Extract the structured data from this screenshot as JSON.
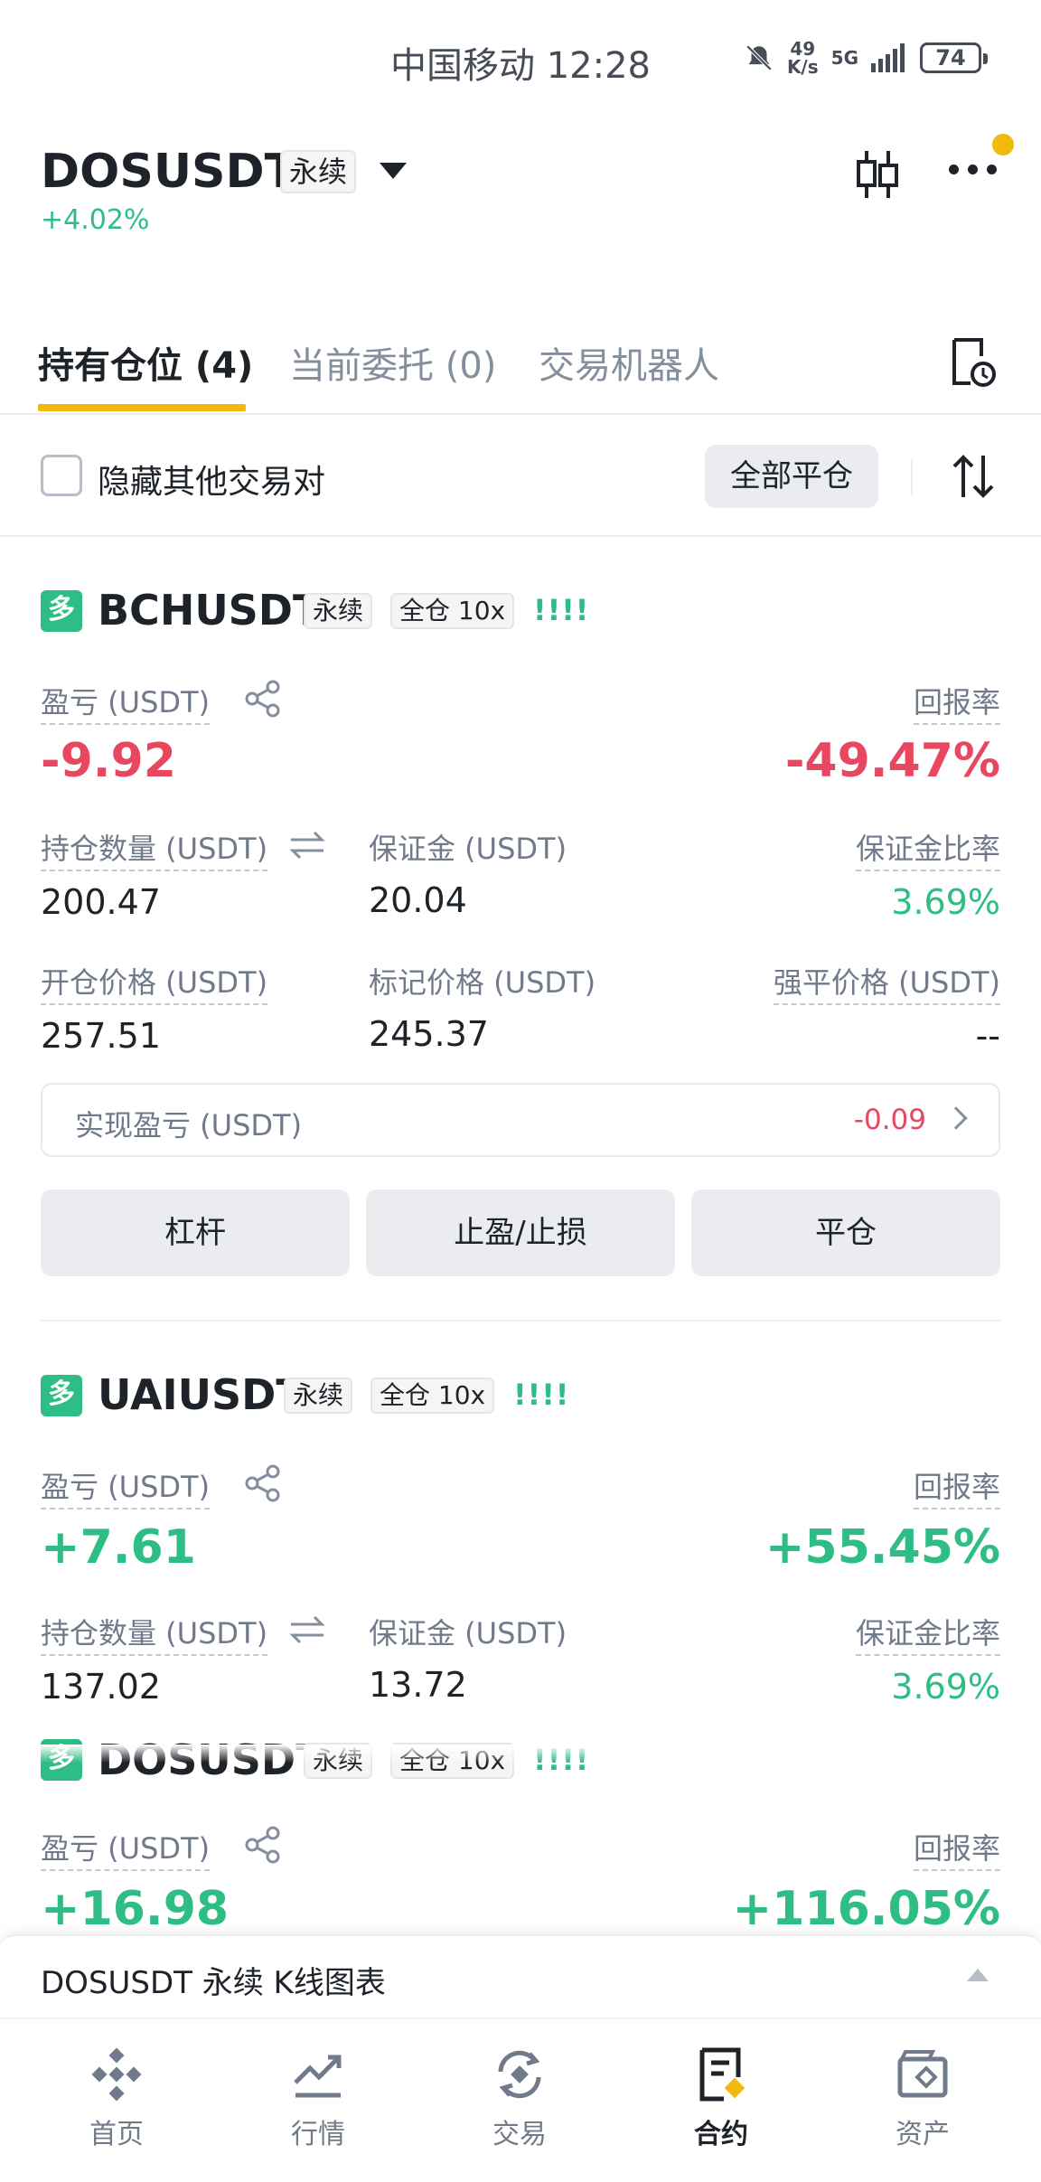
{
  "status_bar": {
    "carrier_time": "中国移动 12:28",
    "speed_value": "49",
    "speed_unit": "K/s",
    "network": "5G",
    "battery": "74"
  },
  "header": {
    "symbol": "DOSUSDT",
    "type_tag": "永续",
    "change": "+4.02%"
  },
  "tabs": [
    {
      "label": "持有仓位 (4)",
      "active": true
    },
    {
      "label": "当前委托 (0)",
      "active": false
    },
    {
      "label": "交易机器人",
      "active": false
    }
  ],
  "filter": {
    "hide_label": "隐藏其他交易对",
    "close_all": "全部平仓"
  },
  "positions": [
    {
      "side": "多",
      "symbol": "BCHUSDT",
      "type_tag": "永续",
      "margin_tag": "全仓 10x",
      "bars": "!!!!",
      "pnl_label": "盈亏 (USDT)",
      "pnl": "-9.92",
      "roe_label": "回报率",
      "roe": "-49.47%",
      "size_label": "持仓数量 (USDT)",
      "size": "200.47",
      "margin_label": "保证金 (USDT)",
      "margin": "20.04",
      "margin_ratio_label": "保证金比率",
      "margin_ratio": "3.69%",
      "entry_label": "开仓价格 (USDT)",
      "entry": "257.51",
      "mark_label": "标记价格 (USDT)",
      "mark": "245.37",
      "liq_label": "强平价格 (USDT)",
      "liq": "--",
      "realized_label": "实现盈亏 (USDT)",
      "realized": "-0.09",
      "btn_leverage": "杠杆",
      "btn_tpsl": "止盈/止损",
      "btn_close": "平仓"
    },
    {
      "side": "多",
      "symbol": "UAIUSDT",
      "type_tag": "永续",
      "margin_tag": "全仓 10x",
      "bars": "!!!!",
      "pnl_label": "盈亏 (USDT)",
      "pnl": "+7.61",
      "roe_label": "回报率",
      "roe": "+55.45%",
      "size_label": "持仓数量 (USDT)",
      "size": "137.02",
      "margin_label": "保证金 (USDT)",
      "margin": "13.72",
      "margin_ratio_label": "保证金比率",
      "margin_ratio": "3.69%"
    },
    {
      "side": "多",
      "symbol": "DOSUSDT",
      "type_tag": "永续",
      "margin_tag": "全仓 10x",
      "bars": "!!!!",
      "pnl_label": "盈亏 (USDT)",
      "pnl": "+16.98",
      "roe_label": "回报率",
      "roe": "+116.05%"
    }
  ],
  "chart_bar": {
    "label": "DOSUSDT 永续 K线图表"
  },
  "bottom_nav": [
    {
      "label": "首页",
      "icon": "home-icon"
    },
    {
      "label": "行情",
      "icon": "markets-icon"
    },
    {
      "label": "交易",
      "icon": "trade-icon"
    },
    {
      "label": "合约",
      "icon": "futures-icon",
      "active": true
    },
    {
      "label": "资产",
      "icon": "wallet-icon"
    }
  ],
  "colors": {
    "accent": "#f0b90b",
    "up": "#2ebd85",
    "down": "#e8475f",
    "text": "#1e2329",
    "muted": "#707a8a"
  }
}
